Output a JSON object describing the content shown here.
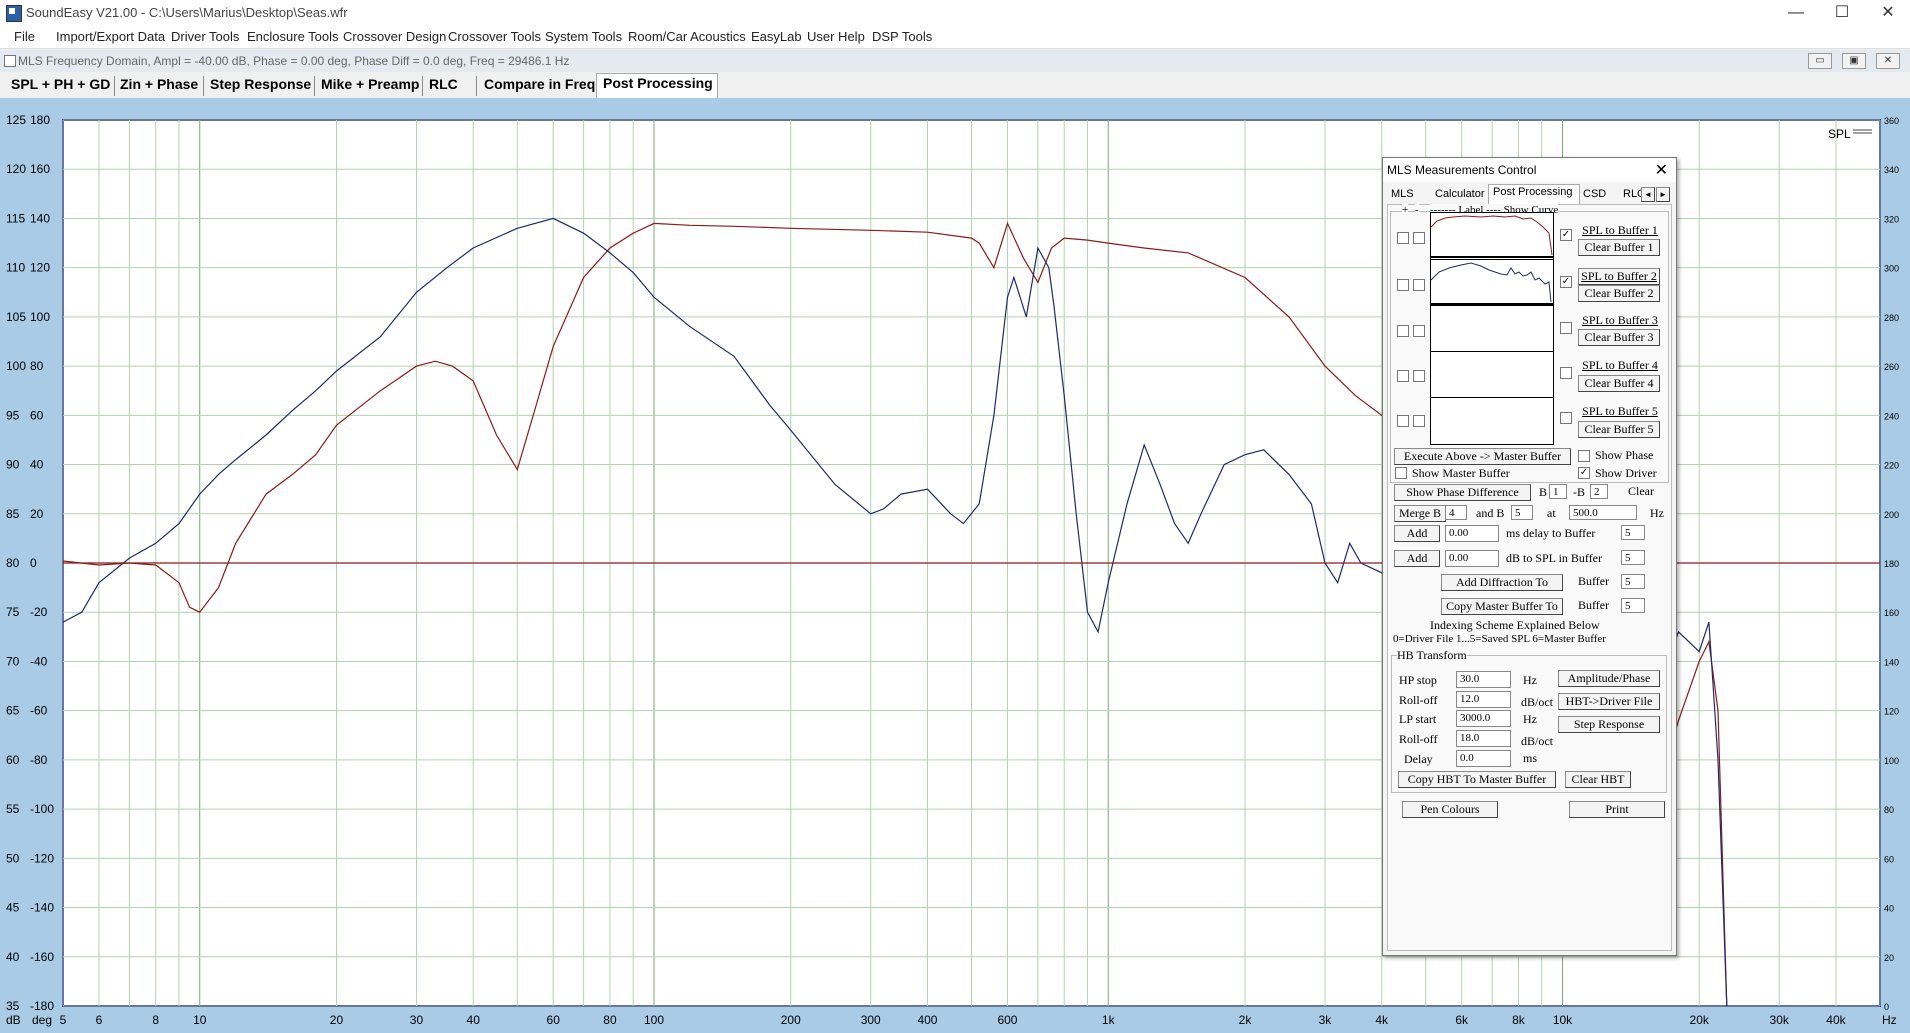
{
  "window": {
    "title": "SoundEasy V21.00 - C:\\Users\\Marius\\Desktop\\Seas.wfr",
    "minimize": "—",
    "maximize": "☐",
    "close": "✕"
  },
  "menu": [
    "File",
    "Import/Export Data",
    "Driver Tools",
    "Enclosure Tools",
    "Crossover Design",
    "Crossover Tools",
    "System Tools",
    "Room/Car Acoustics",
    "EasyLab",
    "User Help",
    "DSP Tools"
  ],
  "mdi": {
    "title": "MLS Frequency Domain, Ampl = -40.00 dB, Phase = 0.00 deg, Phase Diff = 0.0 deg, Freq = 29486.1 Hz",
    "buttons": [
      "▭",
      "▣",
      "✕"
    ]
  },
  "tabs": [
    "SPL + PH + GD",
    "Zin + Phase",
    "Step Response",
    "Mike + Preamp",
    "RLC",
    "Compare in Freq",
    "Post Processing"
  ],
  "active_tab": "Post Processing",
  "chart_data": {
    "type": "line",
    "x_scale": "log",
    "xlim": [
      5,
      50000
    ],
    "x_ticks": [
      5,
      6,
      8,
      10,
      20,
      30,
      40,
      60,
      80,
      100,
      200,
      300,
      400,
      600,
      1000,
      2000,
      3000,
      4000,
      6000,
      8000,
      10000,
      20000,
      30000,
      40000
    ],
    "x_tick_labels": [
      "5",
      "6",
      "8",
      "10",
      "20",
      "30",
      "40",
      "60",
      "80",
      "100",
      "200",
      "300",
      "400",
      "600",
      "1k",
      "2k",
      "3k",
      "4k",
      "6k",
      "8k",
      "10k",
      "20k",
      "30k",
      "40k"
    ],
    "x_unit": "Hz",
    "ylim_db": [
      35,
      125
    ],
    "y_db_ticks": [
      125,
      120,
      115,
      110,
      105,
      100,
      95,
      90,
      85,
      80,
      75,
      70,
      65,
      60,
      55,
      50,
      45,
      40,
      35
    ],
    "y_deg_ticks": [
      180,
      160,
      140,
      120,
      100,
      80,
      60,
      40,
      20,
      0,
      -20,
      -40,
      -60,
      -80,
      -100,
      -120,
      -140,
      -160,
      -180
    ],
    "y_right_ticks": [
      360,
      340,
      320,
      300,
      280,
      260,
      240,
      220,
      200,
      180,
      160,
      140,
      120,
      100,
      80,
      60,
      40,
      20,
      0
    ],
    "y_db_unit": "dB",
    "y_deg_unit": "deg",
    "legend": "SPL",
    "grid": true,
    "series": [
      {
        "color": "#8b1a1a",
        "points": [
          [
            5,
            80.2
          ],
          [
            6,
            79.8
          ],
          [
            7,
            80.0
          ],
          [
            8,
            79.8
          ],
          [
            9,
            78.0
          ],
          [
            9.5,
            75.5
          ],
          [
            10,
            75.0
          ],
          [
            11,
            77.5
          ],
          [
            12,
            82
          ],
          [
            14,
            87
          ],
          [
            16,
            89
          ],
          [
            18,
            91
          ],
          [
            20,
            94
          ],
          [
            25,
            97.5
          ],
          [
            30,
            100
          ],
          [
            33,
            100.5
          ],
          [
            36,
            100
          ],
          [
            40,
            98.5
          ],
          [
            45,
            93
          ],
          [
            50,
            89.5
          ],
          [
            55,
            96
          ],
          [
            60,
            102
          ],
          [
            70,
            109
          ],
          [
            80,
            112
          ],
          [
            90,
            113.5
          ],
          [
            100,
            114.5
          ],
          [
            120,
            114.3
          ],
          [
            150,
            114.2
          ],
          [
            200,
            114
          ],
          [
            300,
            113.8
          ],
          [
            400,
            113.6
          ],
          [
            500,
            113
          ],
          [
            520,
            112.5
          ],
          [
            560,
            110
          ],
          [
            600,
            114.5
          ],
          [
            650,
            111
          ],
          [
            700,
            108.5
          ],
          [
            750,
            112
          ],
          [
            800,
            113
          ],
          [
            900,
            112.8
          ],
          [
            1000,
            112.5
          ],
          [
            1200,
            112
          ],
          [
            1500,
            111.5
          ],
          [
            2000,
            109
          ],
          [
            2500,
            105
          ],
          [
            3000,
            100
          ],
          [
            3500,
            97
          ],
          [
            4000,
            95
          ],
          [
            4500,
            93
          ],
          [
            5000,
            91.5
          ],
          [
            7000,
            88
          ],
          [
            10000,
            83
          ],
          [
            14000,
            73
          ],
          [
            16000,
            62
          ],
          [
            17000,
            60
          ],
          [
            18000,
            64
          ],
          [
            20000,
            70
          ],
          [
            21000,
            72
          ],
          [
            22000,
            65
          ],
          [
            23000,
            35
          ]
        ]
      },
      {
        "color": "#1f2a6b",
        "points": [
          [
            5,
            74
          ],
          [
            5.5,
            75
          ],
          [
            6,
            78
          ],
          [
            7,
            80.5
          ],
          [
            8,
            82
          ],
          [
            9,
            84
          ],
          [
            10,
            87
          ],
          [
            11,
            89
          ],
          [
            12,
            90.5
          ],
          [
            14,
            93
          ],
          [
            16,
            95.5
          ],
          [
            18,
            97.5
          ],
          [
            20,
            99.5
          ],
          [
            25,
            103
          ],
          [
            30,
            107.5
          ],
          [
            35,
            110
          ],
          [
            40,
            112
          ],
          [
            50,
            114
          ],
          [
            60,
            115
          ],
          [
            70,
            113.5
          ],
          [
            80,
            111.5
          ],
          [
            90,
            109.5
          ],
          [
            100,
            107
          ],
          [
            120,
            104
          ],
          [
            150,
            101
          ],
          [
            180,
            96
          ],
          [
            200,
            93.5
          ],
          [
            250,
            88
          ],
          [
            300,
            85
          ],
          [
            320,
            85.5
          ],
          [
            350,
            87
          ],
          [
            400,
            87.5
          ],
          [
            450,
            85
          ],
          [
            480,
            84
          ],
          [
            520,
            86
          ],
          [
            560,
            95
          ],
          [
            600,
            107
          ],
          [
            620,
            109
          ],
          [
            660,
            105
          ],
          [
            700,
            112
          ],
          [
            740,
            110
          ],
          [
            760,
            106
          ],
          [
            800,
            97
          ],
          [
            850,
            85
          ],
          [
            900,
            75
          ],
          [
            950,
            73
          ],
          [
            1000,
            78
          ],
          [
            1100,
            86
          ],
          [
            1200,
            92
          ],
          [
            1300,
            88
          ],
          [
            1400,
            84
          ],
          [
            1500,
            82
          ],
          [
            1600,
            85
          ],
          [
            1800,
            90
          ],
          [
            2000,
            91
          ],
          [
            2200,
            91.5
          ],
          [
            2500,
            89
          ],
          [
            2800,
            86
          ],
          [
            3000,
            80
          ],
          [
            3200,
            78
          ],
          [
            3400,
            82
          ],
          [
            3600,
            80
          ],
          [
            4000,
            79
          ],
          [
            5000,
            77
          ],
          [
            7000,
            76
          ],
          [
            10000,
            74
          ],
          [
            14000,
            71
          ],
          [
            16000,
            72
          ],
          [
            17000,
            70
          ],
          [
            18000,
            73
          ],
          [
            20000,
            71
          ],
          [
            21000,
            74
          ],
          [
            22000,
            60
          ],
          [
            23000,
            35
          ]
        ]
      },
      {
        "color": "#8b1a1a",
        "points": [
          [
            5,
            80
          ],
          [
            50000,
            80
          ]
        ]
      }
    ]
  },
  "dialog": {
    "title": "MLS Measurements Control",
    "close": "✕",
    "tabs": [
      "MLS",
      "Calculator",
      "Post Processing",
      "CSD",
      "RLC"
    ],
    "active_tab": "Post Processing",
    "scroll_left": "◄",
    "scroll_right": "►",
    "header": {
      "plus": "+",
      "minus": "-",
      "label": "-------  Label  ----  Show Curve"
    },
    "buffers": [
      {
        "spl": "SPL to Buffer 1",
        "clear": "Clear Buffer 1",
        "checked": true,
        "check": "✓"
      },
      {
        "spl": "SPL to Buffer 2",
        "clear": "Clear Buffer 2",
        "checked": true,
        "check": "✓"
      },
      {
        "spl": "SPL to Buffer 3",
        "clear": "Clear Buffer 3",
        "checked": false,
        "check": ""
      },
      {
        "spl": "SPL to Buffer 4",
        "clear": "Clear Buffer 4",
        "checked": false,
        "check": ""
      },
      {
        "spl": "SPL to Buffer 5",
        "clear": "Clear Buffer 5",
        "checked": false,
        "check": ""
      }
    ],
    "execute": "Execute Above -> Master Buffer",
    "show_phase": "Show Phase",
    "show_phase_checked": false,
    "show_master": "Show Master Buffer",
    "show_master_checked": false,
    "show_driver": "Show Driver",
    "show_driver_checked": true,
    "check_mark": "✓",
    "show_phase_diff": "Show Phase Difference",
    "b_label": "B",
    "b_value": "1",
    "minus_b_label": "-B",
    "minus_b_value": "2",
    "clear": "Clear",
    "merge": "Merge B",
    "merge_b1": "4",
    "and_b": "and B",
    "merge_b2": "5",
    "at": "at",
    "merge_freq": "500.0",
    "hz": "Hz",
    "add": "Add",
    "delay_value": "0.00",
    "delay_label": "ms delay to Buffer",
    "delay_buffer": "5",
    "spl_value": "0.00",
    "spl_label": "dB to SPL in Buffer",
    "spl_buffer": "5",
    "add_diffraction": "Add Diffraction To",
    "buffer_label": "Buffer",
    "diffraction_buffer": "5",
    "copy_master": "Copy Master Buffer To",
    "copy_buffer": "5",
    "indexing_title": "Indexing Scheme Explained Below",
    "indexing": "0=Driver File    1...5=Saved SPL    6=Master Buffer",
    "hb": {
      "title": "HB Transform",
      "hp_stop_label": "HP stop",
      "hp_stop": "30.0",
      "rolloff_label": "Roll-off",
      "rolloff1": "12.0",
      "lp_start_label": "LP start",
      "lp_start": "3000.0",
      "rolloff2": "18.0",
      "delay_label": "Delay",
      "delay": "0.0",
      "hz": "Hz",
      "dboct": "dB/oct",
      "ms": "ms",
      "amplitude_phase": "Amplitude/Phase",
      "hbt_driver": "HBT->Driver File",
      "step_response": "Step Response",
      "copy_hbt": "Copy HBT To Master Buffer",
      "clear_hbt": "Clear HBT"
    },
    "pen_colours": "Pen Colours",
    "print": "Print"
  }
}
